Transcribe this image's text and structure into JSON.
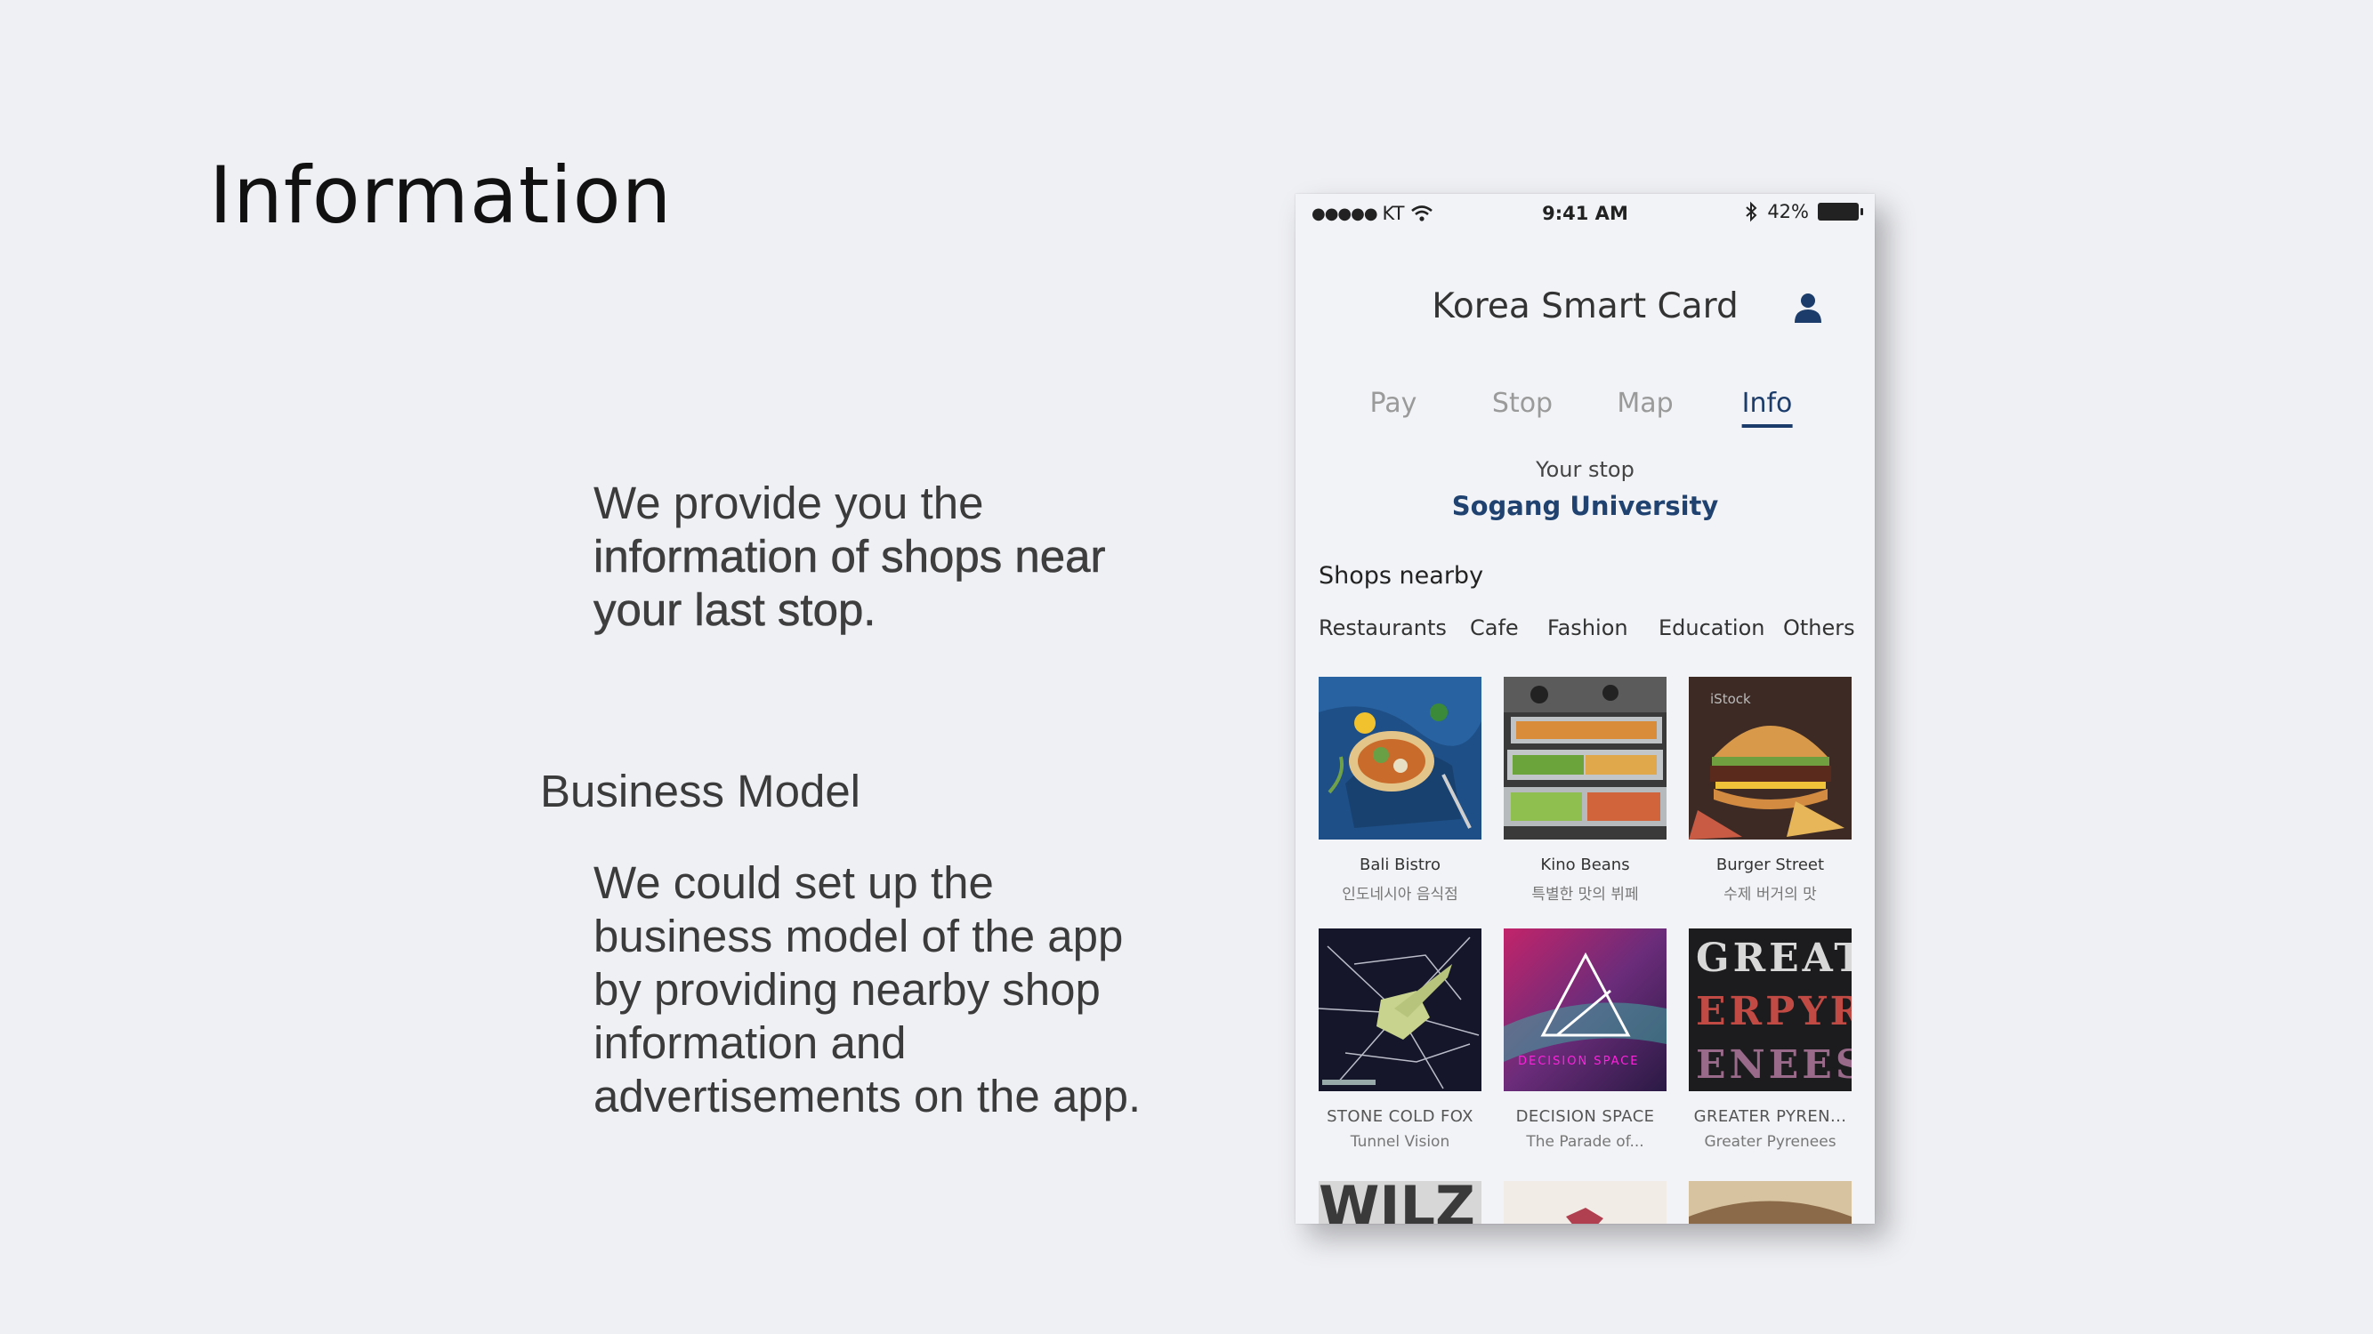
{
  "slide": {
    "title": "Information",
    "intro": {
      "line1": "We provide you the",
      "line2": "information of shops near",
      "line3": "your last stop."
    },
    "business_heading": "Business Model",
    "business_lines": [
      "We could set up the",
      "business model of the app",
      "by providing nearby shop",
      "information and",
      "advertisements on the app."
    ]
  },
  "phone": {
    "status": {
      "dots": "●●●●●",
      "carrier": "KT",
      "time": "9:41 AM",
      "battery": "42%"
    },
    "app_title": "Korea Smart Card",
    "tabs": [
      "Pay",
      "Stop",
      "Map",
      "Info"
    ],
    "active_tab": "Info",
    "stop_label": "Your stop",
    "stop_name": "Sogang University",
    "shops_heading": "Shops nearby",
    "categories": [
      "Restaurants",
      "Cafe",
      "Fashion",
      "Education",
      "Others"
    ],
    "shops": [
      {
        "name": "Bali Bistro",
        "sub": "인도네시아 음식점"
      },
      {
        "name": "Kino Beans",
        "sub": "특별한 맛의 뷔페"
      },
      {
        "name": "Burger Street",
        "sub": "수제 버거의 맛"
      },
      {
        "name": "STONE COLD FOX",
        "sub": "Tunnel Vision"
      },
      {
        "name": "DECISION SPACE",
        "sub": "The Parade of..."
      },
      {
        "name": "GREATER PYREN...",
        "sub": "Greater Pyrenees"
      }
    ],
    "art_text": {
      "decision": "DECISION SPACE",
      "great": "GREAT",
      "erpyr": "ERPYR",
      "enees": "ENEES",
      "wilz": "WILZ",
      "istock": "iStock"
    },
    "colors": {
      "accent": "#1c3d6b",
      "background": "#f2f3f6"
    }
  }
}
